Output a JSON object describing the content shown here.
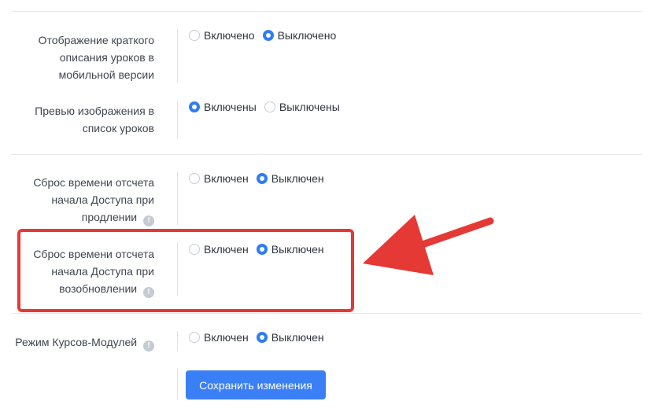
{
  "settings": [
    {
      "label": "Отображение краткого описания уроков в мобильной версии",
      "info": false,
      "options": [
        {
          "label": "Включено",
          "selected": false
        },
        {
          "label": "Выключено",
          "selected": true
        }
      ]
    },
    {
      "label": "Превью изображения в список уроков",
      "info": false,
      "options": [
        {
          "label": "Включены",
          "selected": true
        },
        {
          "label": "Выключены",
          "selected": false
        }
      ]
    },
    {
      "label": "Сброс времени отсчета начала Доступа при продлении",
      "info": true,
      "options": [
        {
          "label": "Включен",
          "selected": false
        },
        {
          "label": "Выключен",
          "selected": true
        }
      ]
    },
    {
      "label": "Сброс времени отсчета начала Доступа при возобновлении",
      "info": true,
      "options": [
        {
          "label": "Включен",
          "selected": false
        },
        {
          "label": "Выключен",
          "selected": true
        }
      ]
    },
    {
      "label": "Режим Курсов-Модулей",
      "info": true,
      "options": [
        {
          "label": "Включен",
          "selected": false
        },
        {
          "label": "Выключен",
          "selected": true
        }
      ]
    }
  ],
  "info_icon_glyph": "!",
  "save_button": {
    "label": "Сохранить изменения"
  },
  "colors": {
    "accent": "#3a7ff6",
    "highlight": "#e53935"
  }
}
